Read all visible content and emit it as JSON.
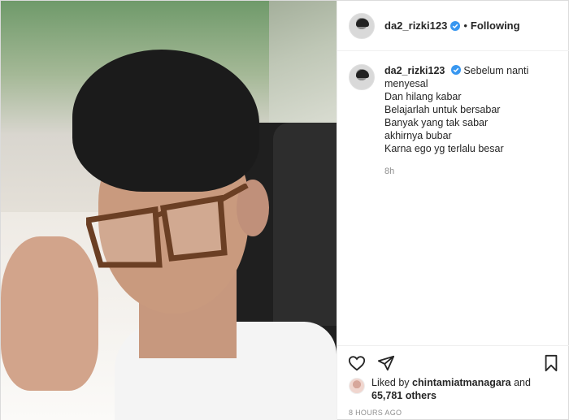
{
  "post": {
    "username": "da2_rizki123",
    "follow_status": "Following",
    "separator": "•",
    "caption": {
      "username": "da2_rizki123",
      "lines": [
        "Sebelum nanti",
        "menyesal",
        "Dan hilang kabar",
        "Belajarlah untuk bersabar",
        "Banyak yang tak sabar",
        "akhirnya bubar",
        "Karna ego yg terlalu besar"
      ],
      "time": "8h"
    },
    "likes": {
      "prefix": "Liked by",
      "liker": "chintamiatmanagara",
      "conj": "and",
      "count": "65,781 others"
    },
    "posted_ago": "8 HOURS AGO"
  },
  "icons": {
    "verified": "verified-badge-icon",
    "like": "heart-icon",
    "share": "paper-plane-icon",
    "save": "bookmark-icon"
  },
  "colors": {
    "verified": "#3897f0",
    "text": "#262626",
    "muted": "#8e8e8e",
    "border": "#efefef"
  }
}
